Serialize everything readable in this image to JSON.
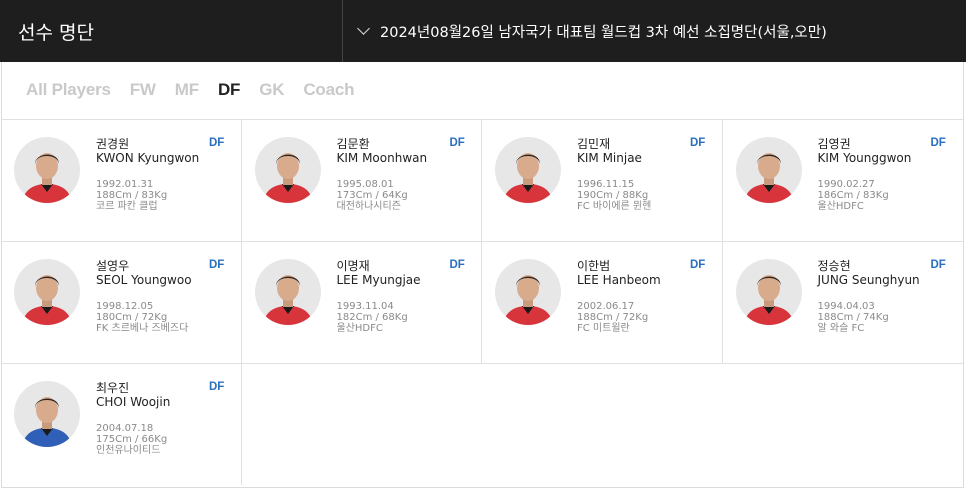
{
  "header": {
    "title": "선수 명단",
    "selected_roster": "2024년08월26일 남자국가 대표팀 월드컵 3차 예선 소집명단(서울,오만)"
  },
  "filters": [
    {
      "label": "All Players",
      "active": false
    },
    {
      "label": "FW",
      "active": false
    },
    {
      "label": "MF",
      "active": false
    },
    {
      "label": "DF",
      "active": true
    },
    {
      "label": "GK",
      "active": false
    },
    {
      "label": "Coach",
      "active": false
    }
  ],
  "players": [
    {
      "name_ko": "권경원",
      "name_en": "KWON Kyungwon",
      "position": "DF",
      "birth": "1992.01.31",
      "body": "188Cm / 83Kg",
      "club": "코르 파칸 클럽",
      "kit": "red"
    },
    {
      "name_ko": "김문환",
      "name_en": "KIM Moonhwan",
      "position": "DF",
      "birth": "1995.08.01",
      "body": "173Cm / 64Kg",
      "club": "대전하나시티즌",
      "kit": "red"
    },
    {
      "name_ko": "김민재",
      "name_en": "KIM Minjae",
      "position": "DF",
      "birth": "1996.11.15",
      "body": "190Cm / 88Kg",
      "club": "FC 바이에른 뮌헨",
      "kit": "red"
    },
    {
      "name_ko": "김영권",
      "name_en": "KIM Younggwon",
      "position": "DF",
      "birth": "1990.02.27",
      "body": "186Cm / 83Kg",
      "club": "울산HDFC",
      "kit": "red"
    },
    {
      "name_ko": "설영우",
      "name_en": "SEOL Youngwoo",
      "position": "DF",
      "birth": "1998.12.05",
      "body": "180Cm / 72Kg",
      "club": "FK 츠르베나 즈베즈다",
      "kit": "red"
    },
    {
      "name_ko": "이명재",
      "name_en": "LEE Myungjae",
      "position": "DF",
      "birth": "1993.11.04",
      "body": "182Cm / 68Kg",
      "club": "울산HDFC",
      "kit": "red"
    },
    {
      "name_ko": "이한범",
      "name_en": "LEE Hanbeom",
      "position": "DF",
      "birth": "2002.06.17",
      "body": "188Cm / 72Kg",
      "club": "FC 미트윌란",
      "kit": "red"
    },
    {
      "name_ko": "정승현",
      "name_en": "JUNG Seunghyun",
      "position": "DF",
      "birth": "1994.04.03",
      "body": "188Cm / 74Kg",
      "club": "알 와슬 FC",
      "kit": "red"
    },
    {
      "name_ko": "최우진",
      "name_en": "CHOI Woojin",
      "position": "DF",
      "birth": "2004.07.18",
      "body": "175Cm / 66Kg",
      "club": "인천유나이티드",
      "kit": "blue"
    }
  ],
  "colors": {
    "header_bg": "#1e1e1e",
    "position_badge": "#2a6fbf",
    "kit_red": "#d8343b",
    "kit_blue": "#2f5fb7"
  }
}
